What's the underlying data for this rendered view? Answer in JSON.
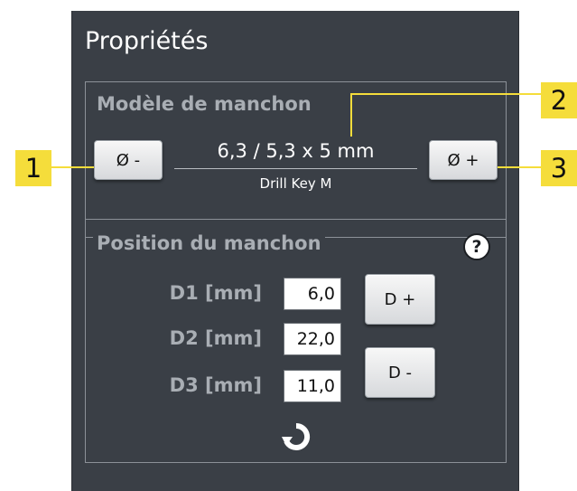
{
  "panel": {
    "title": "Propriétés"
  },
  "sleeve_model": {
    "group_title": "Modèle de manchon",
    "decrease_button": "Ø -",
    "increase_button": "Ø +",
    "value": "6,3 / 5,3 x 5 mm",
    "drill_key": "Drill Key M"
  },
  "sleeve_position": {
    "group_title": "Position du manchon",
    "help_icon": "?",
    "fields": [
      {
        "label": "D1 [mm]",
        "value": "6,0"
      },
      {
        "label": "D2 [mm]",
        "value": "22,0"
      },
      {
        "label": "D3 [mm]",
        "value": "11,0"
      }
    ],
    "d_plus_button": "D +",
    "d_minus_button": "D -",
    "reset_icon": "reset-icon"
  },
  "callouts": [
    "1",
    "2",
    "3"
  ],
  "colors": {
    "panel_bg": "#3a3f46",
    "callout": "#f5dd3b",
    "group_label": "#a9aeb4"
  }
}
